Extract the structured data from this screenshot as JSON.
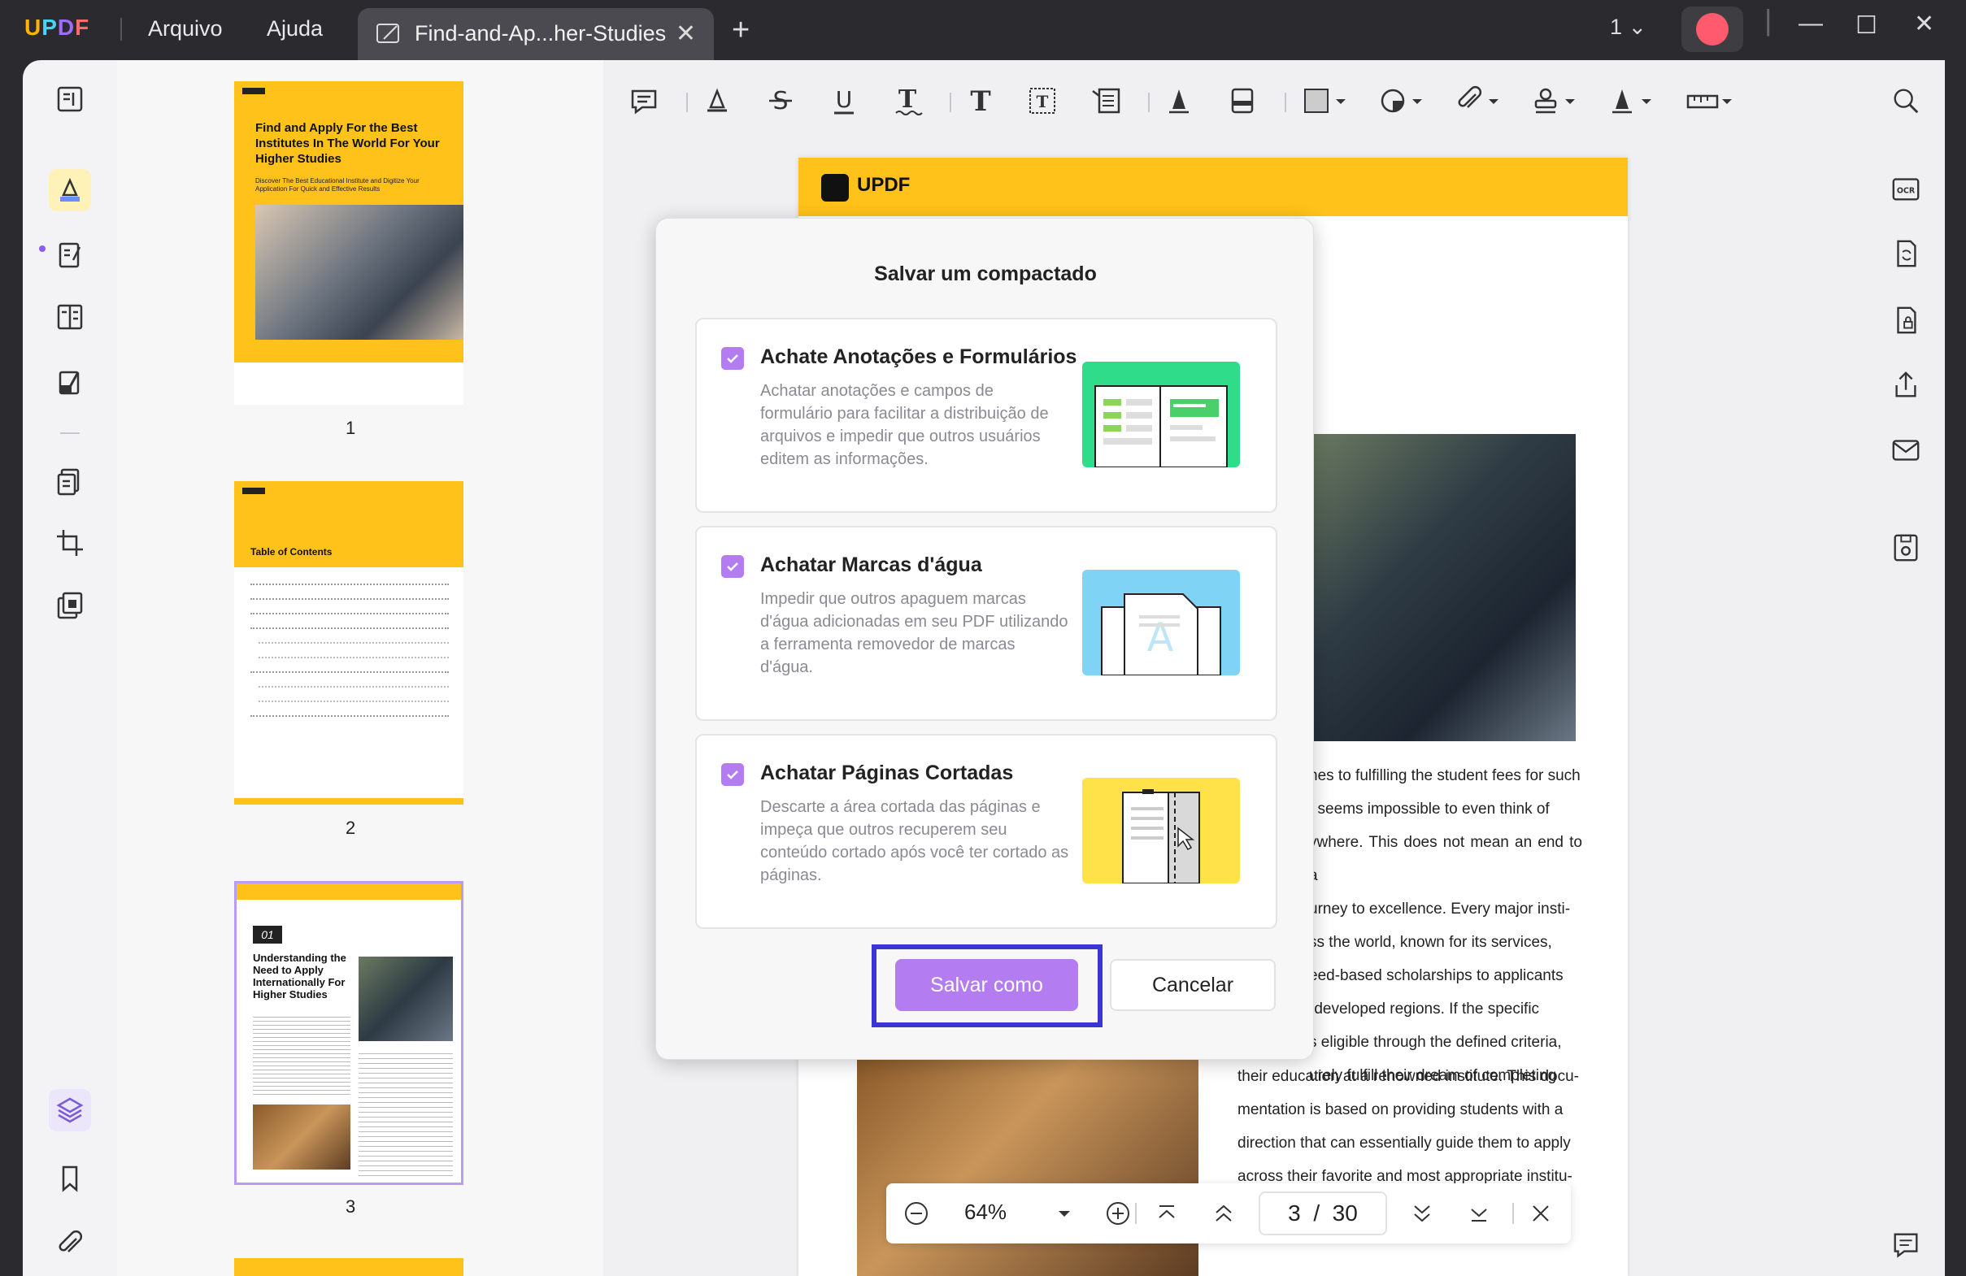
{
  "app": {
    "logo": "UPDF",
    "menu": [
      "Arquivo",
      "Ajuda"
    ],
    "tab_title": "Find-and-Ap...her-Studies",
    "page_indicator": "1"
  },
  "thumbnails": {
    "page1": {
      "number": "1",
      "heading": "Find and Apply For the Best Institutes In The World For Your Higher Studies",
      "sub": "Discover The Best Educational Institute and Digitize Your Application For Quick and Effective Results"
    },
    "page2": {
      "number": "2",
      "heading": "Table of Contents"
    },
    "page3": {
      "number": "3",
      "chapter": "01",
      "heading": "Understanding the Need to Apply Internationally For Higher Studies"
    }
  },
  "document": {
    "banner_logo": "UPDF",
    "text_lines": [
      "nes to fulfilling the student fees for such",
      "t seems impossible to even think of",
      "ywhere. This does not mean an end to a",
      "urney to excellence. Every major insti-",
      "ss the world, known for its services,",
      "eed-based scholarships to applicants",
      "rdeveloped regions. If the specific",
      "s eligible through the defined criteria,",
      "urely fulfill their dream of completing"
    ],
    "text_lines_full": [
      "their education at a renowned institute. This docu-",
      "mentation is based on providing students with a",
      "direction that can essentially guide them to apply",
      "across their favorite and most appropriate institu-"
    ]
  },
  "dialog": {
    "title": "Salvar um compactado",
    "options": [
      {
        "title": "Achate Anotações e Formulários",
        "desc": "Achatar anotações e campos de formulário para facilitar a distribuição de arquivos e impedir que outros usuários editem as informações.",
        "checked": true
      },
      {
        "title": "Achatar Marcas d'água",
        "desc": "Impedir que outros apaguem marcas d'água adicionadas em seu PDF utilizando a ferramenta removedor de marcas d'água.",
        "checked": true
      },
      {
        "title": "Achatar Páginas Cortadas",
        "desc": "Descarte a área cortada das páginas e impeça que outros recuperem seu conteúdo cortado após você ter cortado as páginas.",
        "checked": true
      }
    ],
    "save_label": "Salvar como",
    "cancel_label": "Cancelar"
  },
  "bottom_nav": {
    "zoom": "64%",
    "current_page": "3",
    "separator": "/",
    "total_pages": "30"
  },
  "colors": {
    "accent_purple": "#b37cf0",
    "highlight_blue": "#3b35d6",
    "brand_yellow": "#ffc21a",
    "titlebar": "#2b2b2f"
  }
}
